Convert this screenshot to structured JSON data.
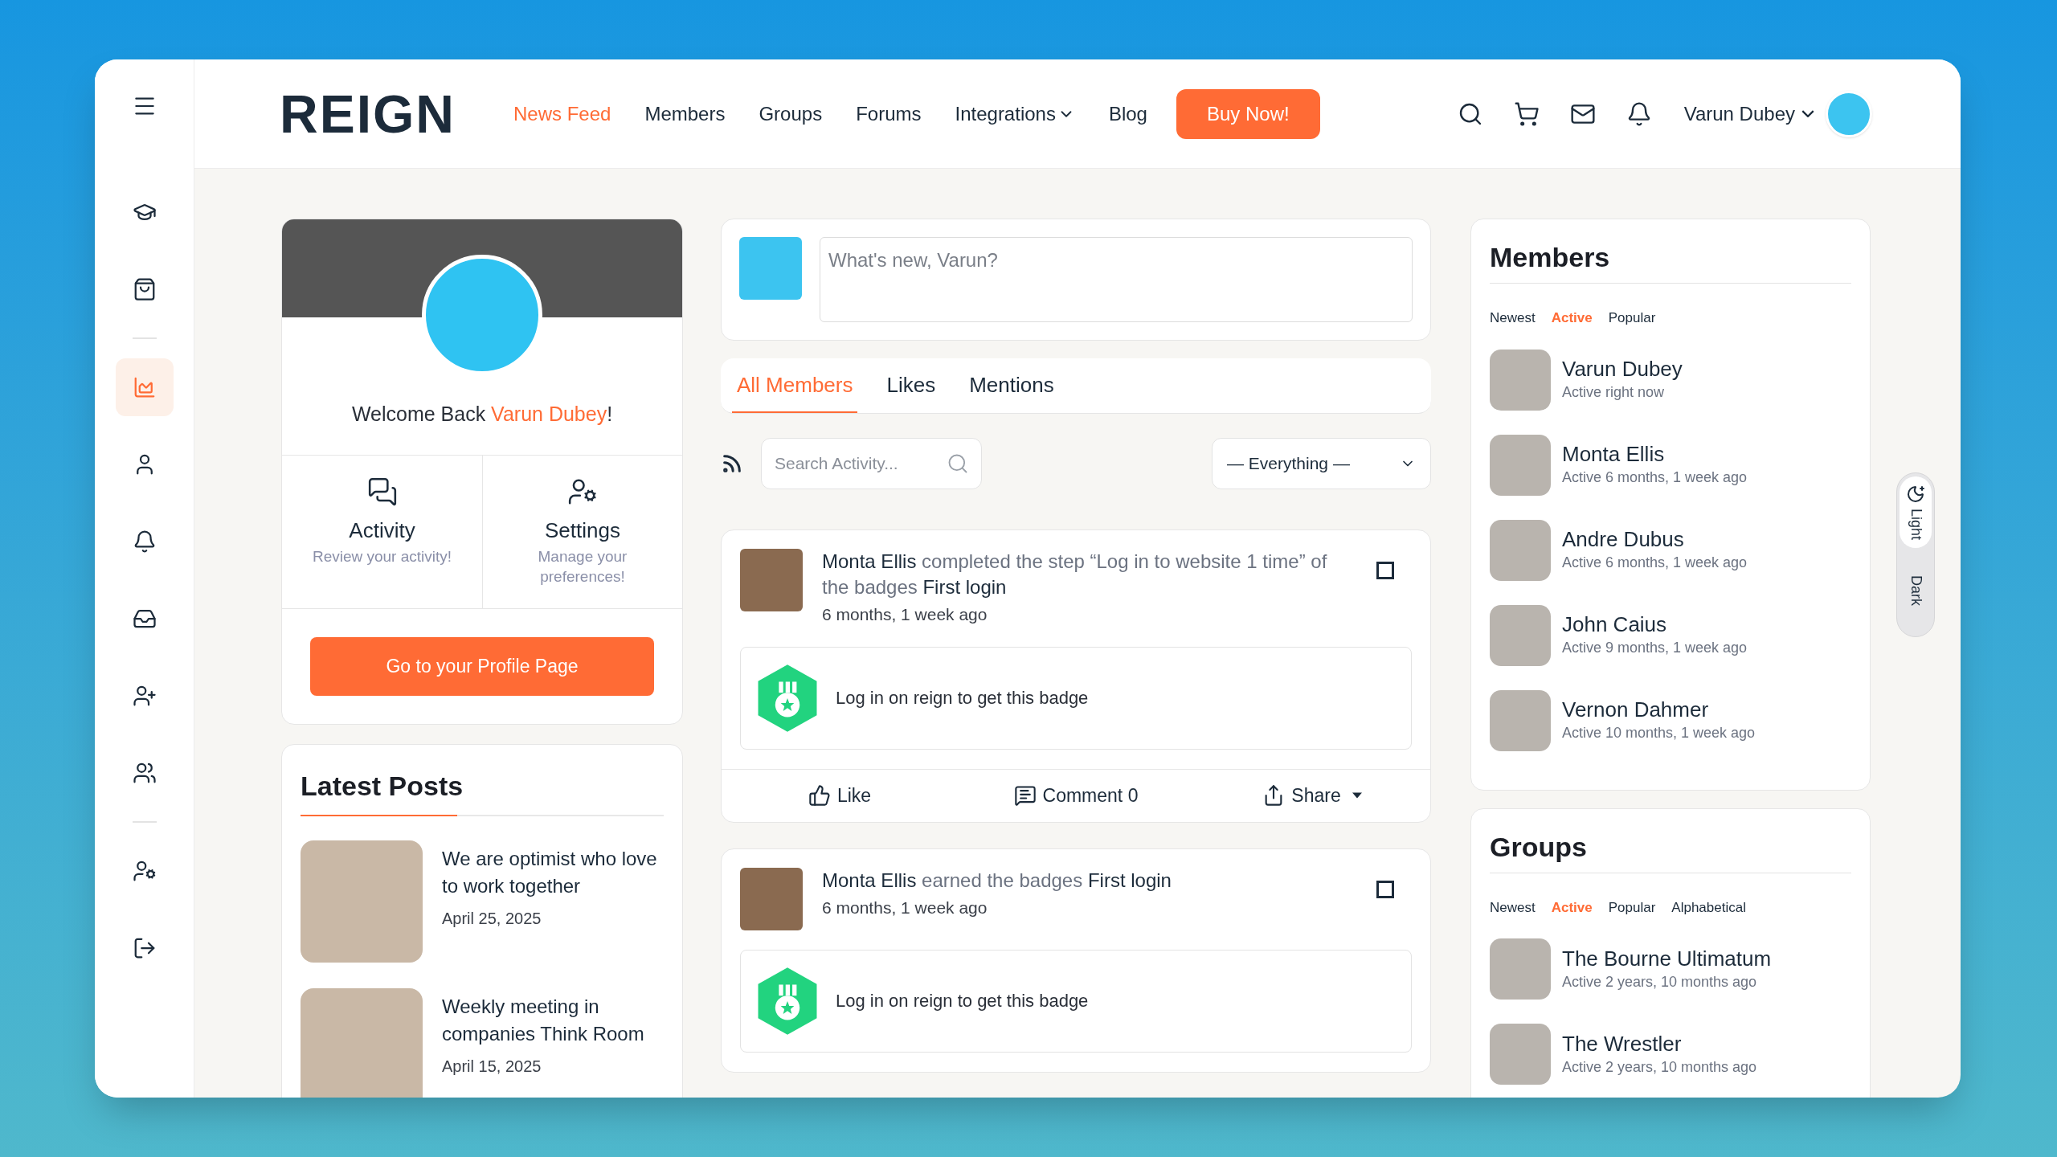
{
  "sidebar": {
    "groups": [
      [
        {
          "selected": false
        },
        {
          "selected": false
        }
      ],
      [
        {
          "selected": true
        },
        {
          "selected": false
        },
        {
          "selected": false
        },
        {
          "selected": false
        },
        {
          "selected": false
        },
        {
          "selected": false
        }
      ],
      [
        {
          "selected": false
        },
        {
          "selected": false
        }
      ]
    ]
  },
  "header": {
    "logo": "REIGN",
    "nav": [
      {
        "label": "News Feed",
        "selected": true,
        "kind": "link"
      },
      {
        "label": "Members",
        "selected": false,
        "kind": "link"
      },
      {
        "label": "Groups",
        "selected": false,
        "kind": "link"
      },
      {
        "label": "Forums",
        "selected": false,
        "kind": "link"
      },
      {
        "label": "Integrations",
        "selected": false,
        "kind": "dropdown"
      },
      {
        "label": "Blog",
        "selected": false,
        "kind": "link"
      }
    ],
    "buy_button": "Buy Now!",
    "user_name": "Varun Dubey"
  },
  "profile_card": {
    "greeting": "Welcome Back",
    "name": "Varun Dubey",
    "suffix": "!",
    "links": [
      {
        "title": "Activity",
        "subtitle": "Review your activity!"
      },
      {
        "title": "Settings",
        "subtitle": "Manage your preferences!"
      }
    ],
    "button": "Go to your Profile Page"
  },
  "latest_posts": {
    "title": "Latest Posts",
    "posts": [
      {
        "title": "We are optimist who love to work together",
        "date": "April 25, 2025"
      },
      {
        "title": "Weekly meeting in companies Think Room",
        "date": "April 15, 2025"
      }
    ]
  },
  "composer": {
    "placeholder": "What's new, Varun?"
  },
  "feed_tabs": [
    {
      "label": "All Members",
      "selected": true
    },
    {
      "label": "Likes",
      "selected": false
    },
    {
      "label": "Mentions",
      "selected": false
    }
  ],
  "filter": {
    "search_placeholder": "Search Activity...",
    "select_value": "— Everything —"
  },
  "activities": [
    {
      "text": "**Monta Ellis** completed the step “Log in to website 1 time” of the badges **First login**",
      "time": "6 months, 1 week ago",
      "checked": false,
      "badge_text": "Log in on reign to get this badge",
      "actions": [
        "Like",
        "Comment 0",
        "Share"
      ]
    },
    {
      "text": "**Monta Ellis** earned the badges **First login**",
      "time": "6 months, 1 week ago",
      "checked": false,
      "badge_text": "Log in on reign to get this badge"
    }
  ],
  "members": {
    "title": "Members",
    "filters": [
      {
        "label": "Newest",
        "selected": false
      },
      {
        "label": "Active",
        "selected": true
      },
      {
        "label": "Popular",
        "selected": false
      }
    ],
    "items": [
      {
        "name": "Varun Dubey",
        "status": "Active right now"
      },
      {
        "name": "Monta Ellis",
        "status": "Active 6 months, 1 week ago"
      },
      {
        "name": "Andre Dubus",
        "status": "Active 6 months, 1 week ago"
      },
      {
        "name": "John Caius",
        "status": "Active 9 months, 1 week ago"
      },
      {
        "name": "Vernon Dahmer",
        "status": "Active 10 months, 1 week ago"
      }
    ]
  },
  "groups": {
    "title": "Groups",
    "filters": [
      {
        "label": "Newest",
        "selected": false
      },
      {
        "label": "Active",
        "selected": true
      },
      {
        "label": "Popular",
        "selected": false
      },
      {
        "label": "Alphabetical",
        "selected": false
      }
    ],
    "items": [
      {
        "name": "The Bourne Ultimatum",
        "status": "Active 2 years, 10 months ago"
      },
      {
        "name": "The Wrestler",
        "status": "Active 2 years, 10 months ago"
      }
    ]
  },
  "theme_toggle": [
    {
      "label": "Light",
      "selected": true
    },
    {
      "label": "Dark",
      "selected": false
    }
  ]
}
